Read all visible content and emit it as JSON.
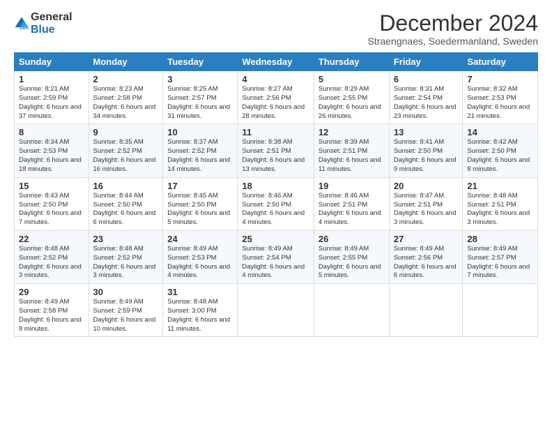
{
  "logo": {
    "general": "General",
    "blue": "Blue"
  },
  "title": "December 2024",
  "subtitle": "Straengnaes, Soedermanland, Sweden",
  "weekdays": [
    "Sunday",
    "Monday",
    "Tuesday",
    "Wednesday",
    "Thursday",
    "Friday",
    "Saturday"
  ],
  "weeks": [
    [
      {
        "day": "1",
        "sunrise": "8:21 AM",
        "sunset": "2:59 PM",
        "daylight": "6 hours and 37 minutes."
      },
      {
        "day": "2",
        "sunrise": "8:23 AM",
        "sunset": "2:58 PM",
        "daylight": "6 hours and 34 minutes."
      },
      {
        "day": "3",
        "sunrise": "8:25 AM",
        "sunset": "2:57 PM",
        "daylight": "6 hours and 31 minutes."
      },
      {
        "day": "4",
        "sunrise": "8:27 AM",
        "sunset": "2:56 PM",
        "daylight": "6 hours and 28 minutes."
      },
      {
        "day": "5",
        "sunrise": "8:29 AM",
        "sunset": "2:55 PM",
        "daylight": "6 hours and 26 minutes."
      },
      {
        "day": "6",
        "sunrise": "8:31 AM",
        "sunset": "2:54 PM",
        "daylight": "6 hours and 23 minutes."
      },
      {
        "day": "7",
        "sunrise": "8:32 AM",
        "sunset": "2:53 PM",
        "daylight": "6 hours and 21 minutes."
      }
    ],
    [
      {
        "day": "8",
        "sunrise": "8:34 AM",
        "sunset": "2:53 PM",
        "daylight": "6 hours and 18 minutes."
      },
      {
        "day": "9",
        "sunrise": "8:35 AM",
        "sunset": "2:52 PM",
        "daylight": "6 hours and 16 minutes."
      },
      {
        "day": "10",
        "sunrise": "8:37 AM",
        "sunset": "2:52 PM",
        "daylight": "6 hours and 14 minutes."
      },
      {
        "day": "11",
        "sunrise": "8:38 AM",
        "sunset": "2:51 PM",
        "daylight": "6 hours and 13 minutes."
      },
      {
        "day": "12",
        "sunrise": "8:39 AM",
        "sunset": "2:51 PM",
        "daylight": "6 hours and 11 minutes."
      },
      {
        "day": "13",
        "sunrise": "8:41 AM",
        "sunset": "2:50 PM",
        "daylight": "6 hours and 9 minutes."
      },
      {
        "day": "14",
        "sunrise": "8:42 AM",
        "sunset": "2:50 PM",
        "daylight": "6 hours and 8 minutes."
      }
    ],
    [
      {
        "day": "15",
        "sunrise": "8:43 AM",
        "sunset": "2:50 PM",
        "daylight": "6 hours and 7 minutes."
      },
      {
        "day": "16",
        "sunrise": "8:44 AM",
        "sunset": "2:50 PM",
        "daylight": "6 hours and 6 minutes."
      },
      {
        "day": "17",
        "sunrise": "8:45 AM",
        "sunset": "2:50 PM",
        "daylight": "6 hours and 5 minutes."
      },
      {
        "day": "18",
        "sunrise": "8:46 AM",
        "sunset": "2:50 PM",
        "daylight": "6 hours and 4 minutes."
      },
      {
        "day": "19",
        "sunrise": "8:46 AM",
        "sunset": "2:51 PM",
        "daylight": "6 hours and 4 minutes."
      },
      {
        "day": "20",
        "sunrise": "8:47 AM",
        "sunset": "2:51 PM",
        "daylight": "6 hours and 3 minutes."
      },
      {
        "day": "21",
        "sunrise": "8:48 AM",
        "sunset": "2:51 PM",
        "daylight": "6 hours and 3 minutes."
      }
    ],
    [
      {
        "day": "22",
        "sunrise": "8:48 AM",
        "sunset": "2:52 PM",
        "daylight": "6 hours and 3 minutes."
      },
      {
        "day": "23",
        "sunrise": "8:48 AM",
        "sunset": "2:52 PM",
        "daylight": "6 hours and 3 minutes."
      },
      {
        "day": "24",
        "sunrise": "8:49 AM",
        "sunset": "2:53 PM",
        "daylight": "6 hours and 4 minutes."
      },
      {
        "day": "25",
        "sunrise": "8:49 AM",
        "sunset": "2:54 PM",
        "daylight": "6 hours and 4 minutes."
      },
      {
        "day": "26",
        "sunrise": "8:49 AM",
        "sunset": "2:55 PM",
        "daylight": "6 hours and 5 minutes."
      },
      {
        "day": "27",
        "sunrise": "8:49 AM",
        "sunset": "2:56 PM",
        "daylight": "6 hours and 6 minutes."
      },
      {
        "day": "28",
        "sunrise": "8:49 AM",
        "sunset": "2:57 PM",
        "daylight": "6 hours and 7 minutes."
      }
    ],
    [
      {
        "day": "29",
        "sunrise": "8:49 AM",
        "sunset": "2:58 PM",
        "daylight": "6 hours and 8 minutes."
      },
      {
        "day": "30",
        "sunrise": "8:49 AM",
        "sunset": "2:59 PM",
        "daylight": "6 hours and 10 minutes."
      },
      {
        "day": "31",
        "sunrise": "8:48 AM",
        "sunset": "3:00 PM",
        "daylight": "6 hours and 11 minutes."
      },
      null,
      null,
      null,
      null
    ]
  ]
}
